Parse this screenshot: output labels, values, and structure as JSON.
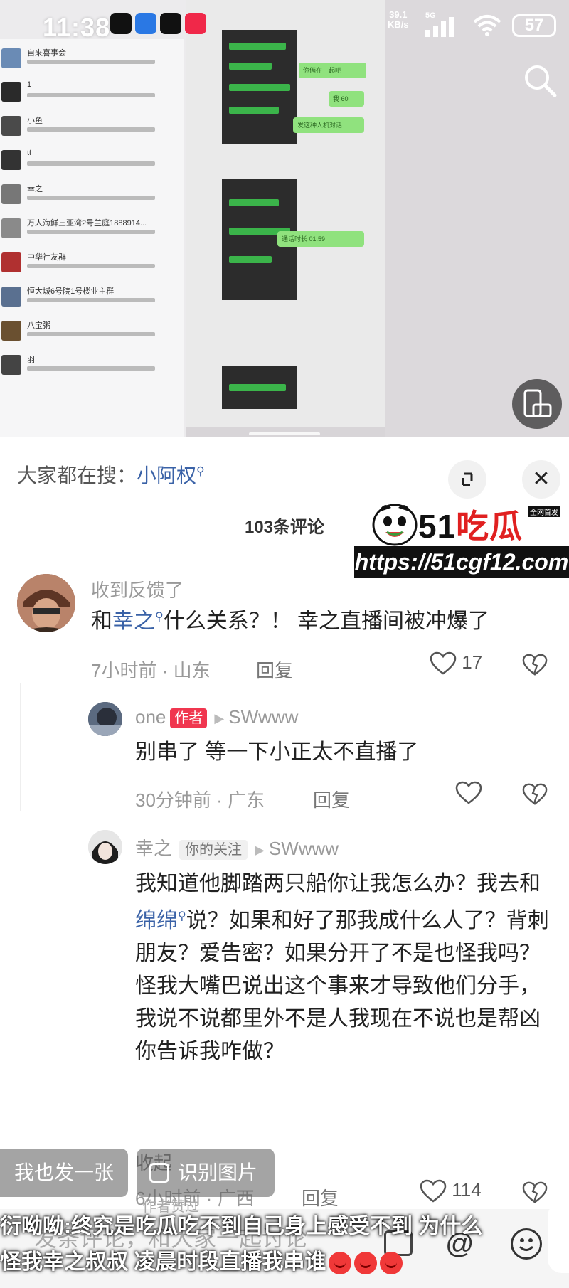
{
  "status_bar": {
    "time": "11:38",
    "net_speed_value": "39.1",
    "net_speed_unit": "KB/s",
    "network": "5G",
    "battery": "57"
  },
  "background_screenshot": {
    "chat_list": [
      {
        "name": "自来喜事会"
      },
      {
        "name": "1"
      },
      {
        "name": "小鱼"
      },
      {
        "name": "tt"
      },
      {
        "name": "幸之"
      },
      {
        "name": "万人海鲜三亚湾2号兰庭1888914..."
      },
      {
        "name": "中华社友群"
      },
      {
        "name": "恒大城6号院1号楼业主群"
      },
      {
        "name": "八宝粥"
      },
      {
        "name": "羽"
      }
    ],
    "bubbles": [
      "你俩在一起吧",
      "我 60",
      "发这种人机对话",
      "通话时长 01:59"
    ]
  },
  "comment_sheet": {
    "search_prefix": "大家都在搜：",
    "search_term": "小阿权",
    "comment_count": "103条评论",
    "close_symbol": "✕",
    "comments": [
      {
        "username": "收到反馈了",
        "text_pre": "和",
        "text_link": "幸之",
        "text_post": "什么关系？！ 幸之直播间被冲爆了",
        "meta": "7小时前 · 山东",
        "reply": "回复",
        "likes": "17"
      },
      {
        "username": "one",
        "author_tag": "作者",
        "reply_to": "SWwww",
        "text": "别串了 等一下小正太不直播了",
        "meta": "30分钟前 · 广东",
        "reply": "回复",
        "likes": ""
      },
      {
        "username": "幸之",
        "follow_tag": "你的关注",
        "reply_to": "SWwww",
        "text_pre": "我知道他脚踏两只船你让我怎么办？我去和",
        "text_link": "绵绵",
        "text_post": "说？如果和好了那我成什么人了？背刺朋友？爱告密？如果分开了不是也怪我吗？怪我大嘴巴说出这个事来才导致他们分手，我说不说都里外不是人我现在不说也是帮凶你告诉我咋做？",
        "collapse": "收起",
        "meta": "6小时前 · 广西",
        "reply": "回复",
        "likes": "114"
      }
    ]
  },
  "watermark": {
    "logo_num": "51",
    "logo_cn": "吃瓜",
    "logo_tag": "全网首发",
    "url": "https://51cgf12.com"
  },
  "overlays": {
    "post_photo": "我也发一张",
    "recognize_image": "识别图片",
    "author_reviewed": "作者赞过",
    "input_placeholder": "发条评论，和大家一起讨论",
    "caption_line1": "衍呦呦:终究是吃瓜吃不到自己身上感受不到 为什么",
    "caption_line2": "怪我幸之叔叔 凌晨时段直播我串谁",
    "at_symbol": "@"
  },
  "colors": {
    "link": "#3a62a7",
    "author_tag": "#f0364f",
    "wechat_green": "#3bb44a"
  }
}
